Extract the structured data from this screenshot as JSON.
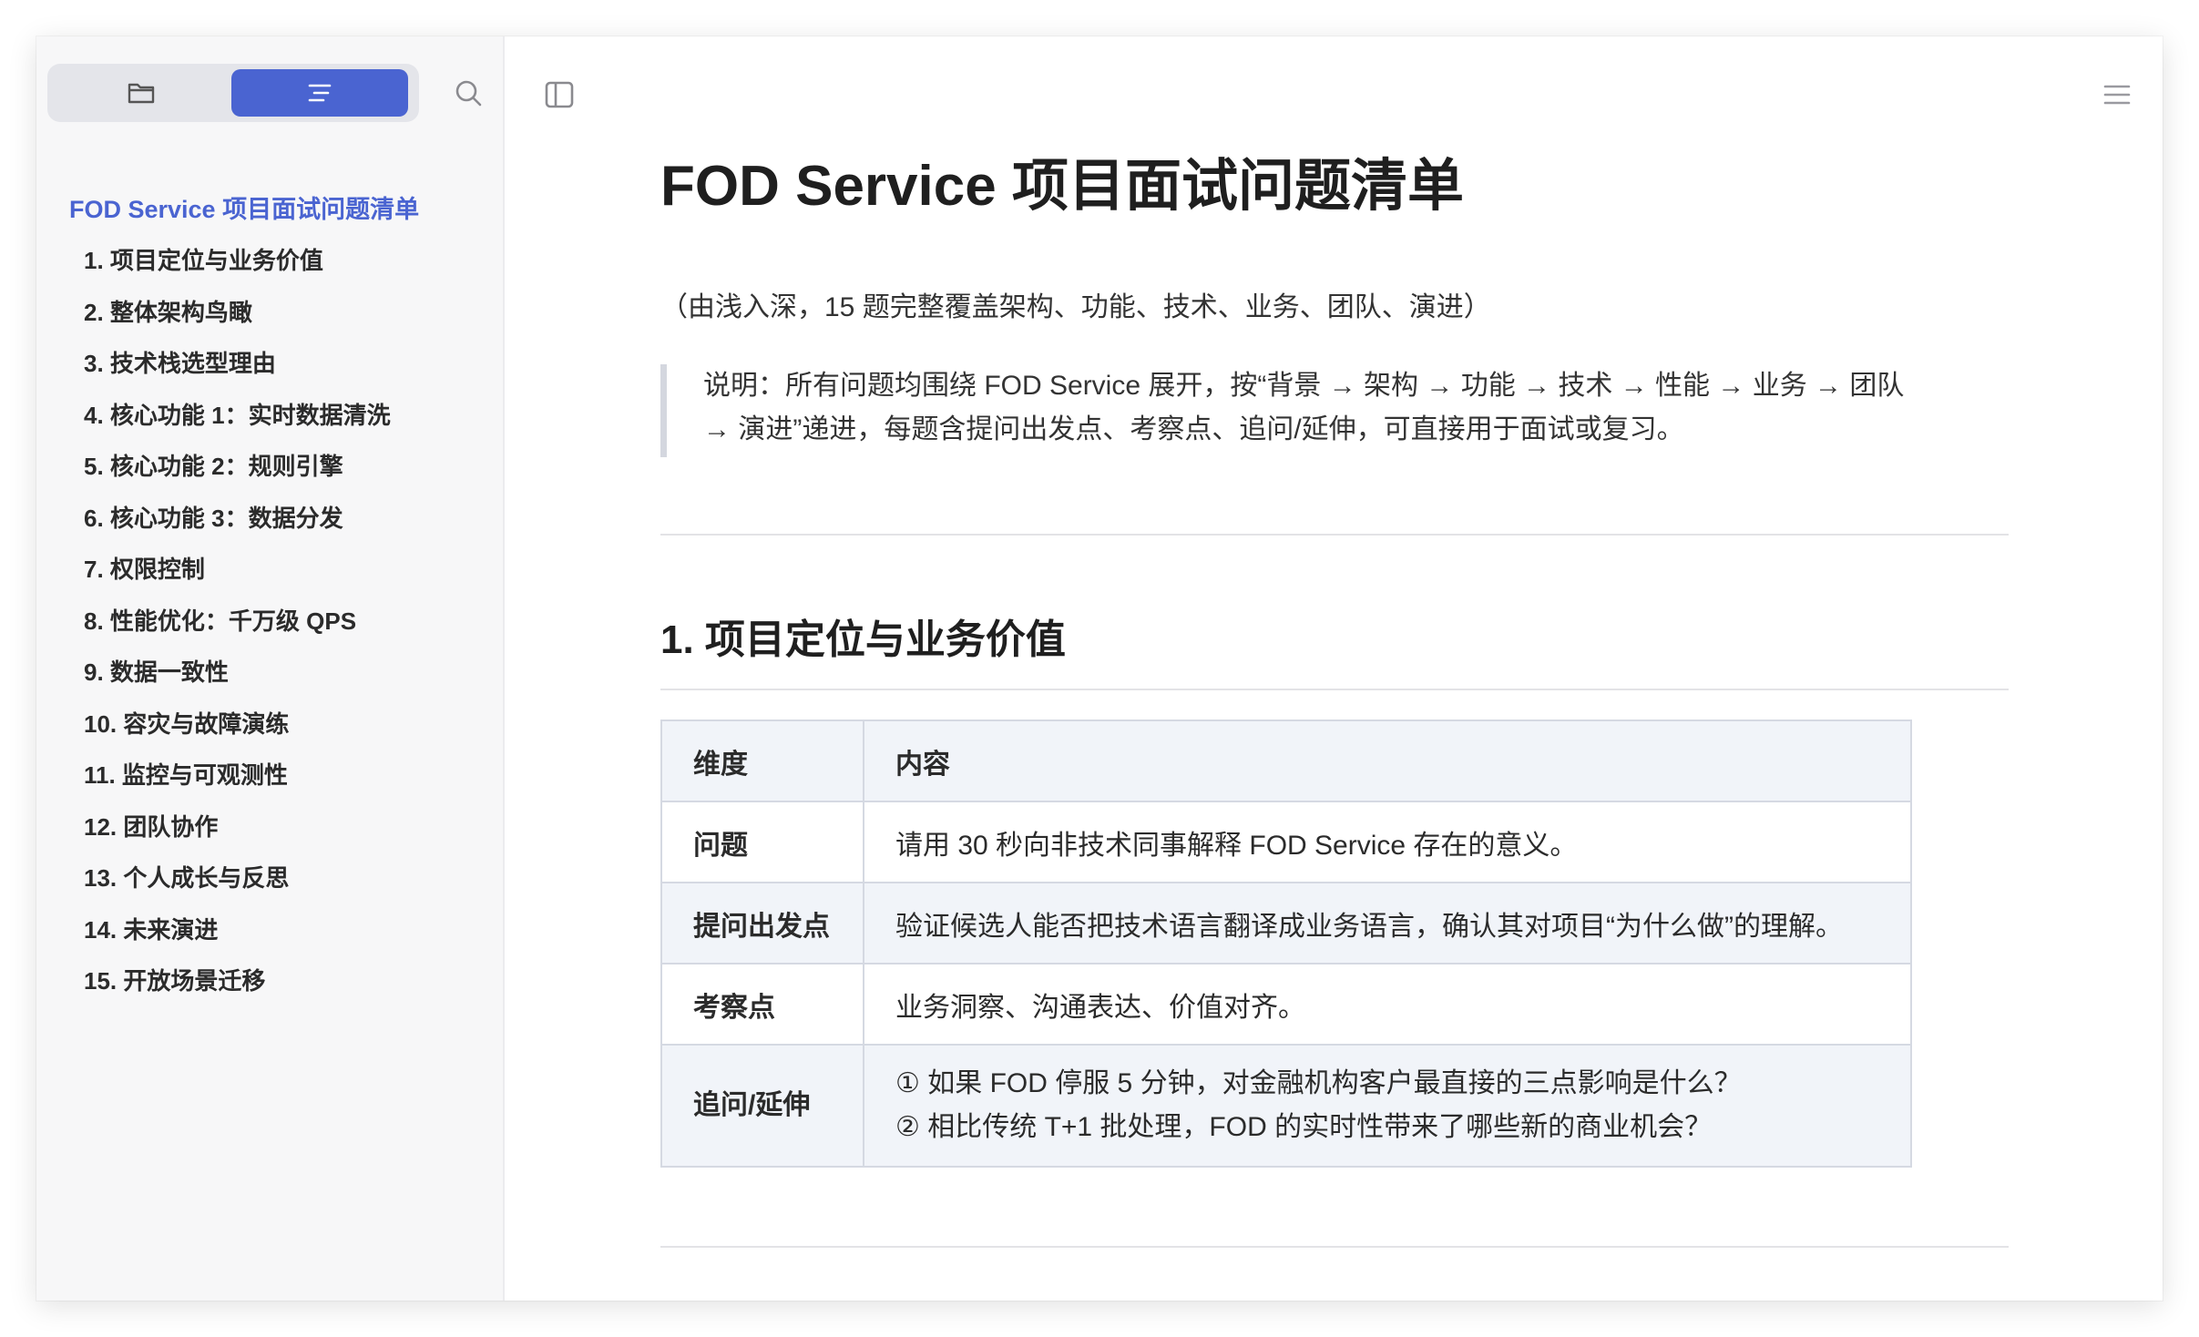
{
  "sidebar": {
    "tabs": [
      {
        "icon": "folder-icon",
        "active": false
      },
      {
        "icon": "outline-icon",
        "active": true
      }
    ],
    "search_icon": "search-icon",
    "outline_title": "FOD Service 项目面试问题清单",
    "items": [
      "1. 项目定位与业务价值",
      "2. 整体架构鸟瞰",
      "3. 技术栈选型理由",
      "4. 核心功能 1：实时数据清洗",
      "5. 核心功能 2：规则引擎",
      "6. 核心功能 3：数据分发",
      "7. 权限控制",
      "8. 性能优化：千万级 QPS",
      "9. 数据一致性",
      "10. 容灾与故障演练",
      "11. 监控与可观测性",
      "12. 团队协作",
      "13. 个人成长与反思",
      "14. 未来演进",
      "15. 开放场景迁移"
    ],
    "accent_color": "#4a64d1"
  },
  "document": {
    "title": "FOD Service 项目面试问题清单",
    "subtitle": "（由浅入深，15 题完整覆盖架构、功能、技术、业务、团队、演进）",
    "note_line1": "说明：所有问题均围绕 FOD Service 展开，按“背景 → 架构 → 功能 → 技术 → 性能 → 业务 → 团队",
    "note_line2": "→ 演进”递进，每题含提问出发点、考察点、追问/延伸，可直接用于面试或复习。",
    "section1": {
      "heading": "1. 项目定位与业务价值",
      "table": {
        "header": [
          "维度",
          "内容"
        ],
        "rows": [
          {
            "key": "问题",
            "value": "请用 30 秒向非技术同事解释 FOD Service 存在的意义。"
          },
          {
            "key": "提问出发点",
            "value": "验证候选人能否把技术语言翻译成业务语言，确认其对项目“为什么做”的理解。"
          },
          {
            "key": "考察点",
            "value": "业务洞察、沟通表达、价值对齐。"
          },
          {
            "key": "追问/延伸",
            "line1": "① 如果 FOD 停服 5 分钟，对金融机构客户最直接的三点影响是什么？",
            "line2": "② 相比传统 T+1 批处理，FOD 的实时性带来了哪些新的商业机会？"
          }
        ]
      }
    }
  },
  "icons": {
    "toggle_sidebar": "sidebar-toggle-icon",
    "menu": "menu-icon"
  }
}
